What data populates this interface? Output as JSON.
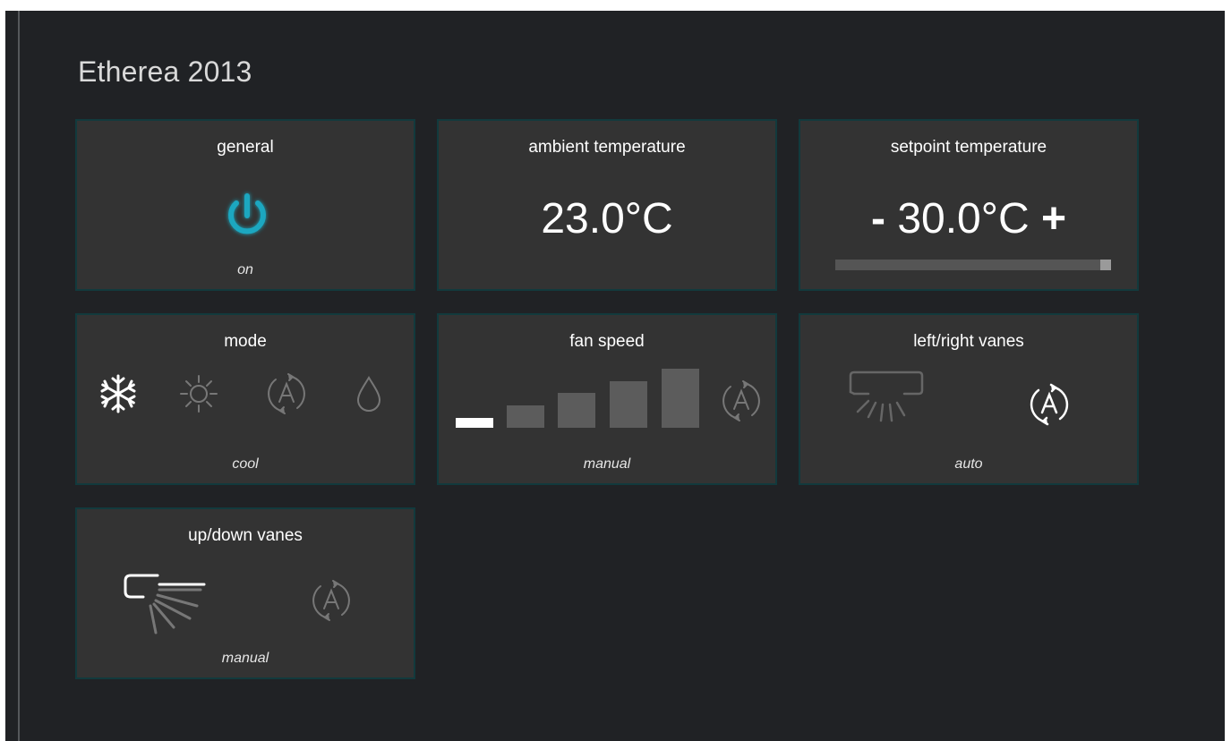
{
  "page": {
    "title": "Etherea 2013"
  },
  "colors": {
    "accent": "#1aa7c0",
    "tile_bg": "#333333",
    "tile_border": "#123a3d",
    "inactive_icon": "#777777"
  },
  "tiles": {
    "general": {
      "title": "general",
      "status": "on",
      "icon": "power-icon"
    },
    "ambient": {
      "title": "ambient temperature",
      "value": "23.0°C"
    },
    "setpoint": {
      "title": "setpoint temperature",
      "minus_label": "-",
      "value": "30.0°C",
      "plus_label": "+",
      "slider_level": 1.0
    },
    "mode": {
      "title": "mode",
      "status": "cool",
      "options": [
        {
          "name": "cool",
          "icon": "snowflake-icon",
          "active": true
        },
        {
          "name": "heat",
          "icon": "sun-icon",
          "active": false
        },
        {
          "name": "auto",
          "icon": "auto-icon",
          "active": false
        },
        {
          "name": "dry",
          "icon": "droplet-icon",
          "active": false
        }
      ]
    },
    "fan": {
      "title": "fan speed",
      "status": "manual",
      "levels": [
        1,
        2,
        3,
        4,
        5
      ],
      "active_level": 1,
      "auto_icon": "auto-icon"
    },
    "lr_vanes": {
      "title": "left/right vanes",
      "status": "auto",
      "icons": [
        "ac-unit-vanes-down-icon",
        "auto-icon"
      ]
    },
    "ud_vanes": {
      "title": "up/down vanes",
      "status": "manual",
      "icons": [
        "ac-unit-vanes-side-icon",
        "auto-icon"
      ]
    }
  }
}
